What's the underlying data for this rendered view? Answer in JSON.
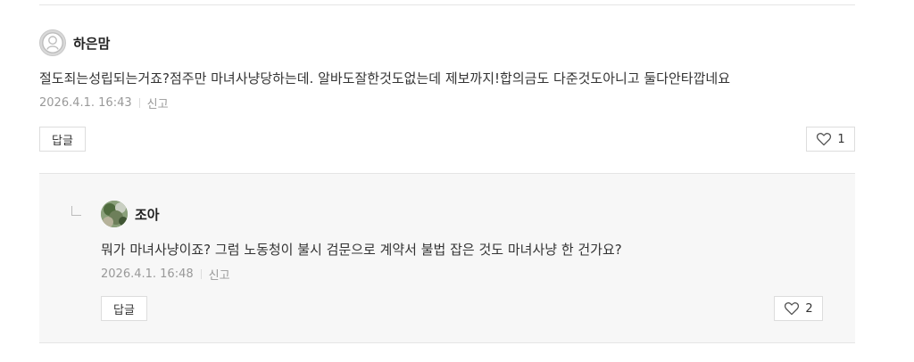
{
  "comments": [
    {
      "author": "하은맘",
      "text": "절도죄는성립되는거죠?점주만 마녀사냥당하는데. 알바도잘한것도없는데 제보까지!합의금도 다준것도아니고 둘다안타깝네요",
      "date": "2026.4.1. 16:43",
      "report_label": "신고",
      "reply_label": "답글",
      "likes": "1",
      "avatar_icon": "default-profile-icon"
    }
  ],
  "replies": [
    {
      "author": "조아",
      "text": "뭐가 마녀사냥이죠? 그럼 노동청이 불시 검문으로 계약서 불법 잡은 것도 마녀사냥 한 건가요?",
      "date": "2026.4.1. 16:48",
      "report_label": "신고",
      "reply_label": "답글",
      "likes": "2",
      "avatar_icon": "profile-photo-icon"
    }
  ],
  "colors": {
    "divider": "#e5e5e5",
    "reply_background": "#f7f7f7",
    "meta_text": "#999999"
  }
}
